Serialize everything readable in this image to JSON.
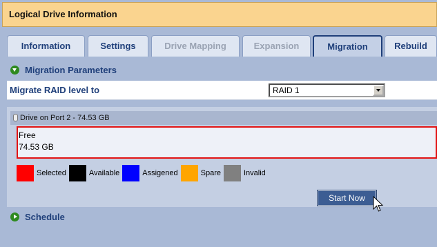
{
  "title": "Logical Drive Information",
  "tabs": [
    {
      "label": "Information",
      "state": "enabled"
    },
    {
      "label": "Settings",
      "state": "enabled"
    },
    {
      "label": "Drive Mapping",
      "state": "disabled"
    },
    {
      "label": "Expansion",
      "state": "disabled"
    },
    {
      "label": "Migration",
      "state": "active"
    },
    {
      "label": "Rebuild",
      "state": "enabled"
    }
  ],
  "migration_section": {
    "title": "Migration Parameters",
    "icon": "chevron-down-circle-icon"
  },
  "raid_field": {
    "label": "Migrate RAID level to",
    "value": "RAID 1"
  },
  "drive": {
    "header": "Drive on Port 2 - 74.53 GB",
    "segment_label": "Free",
    "segment_size": "74.53 GB"
  },
  "legend": [
    {
      "label": "Selected",
      "color": "#ff0000"
    },
    {
      "label": "Available",
      "color": "#000000"
    },
    {
      "label": "Assigened",
      "color": "#0000ff"
    },
    {
      "label": "Spare",
      "color": "#ffa500"
    },
    {
      "label": "Invalid",
      "color": "#808080"
    }
  ],
  "start_button": {
    "label": "Start Now"
  },
  "schedule_section": {
    "title": "Schedule",
    "icon": "chevron-right-circle-icon"
  }
}
